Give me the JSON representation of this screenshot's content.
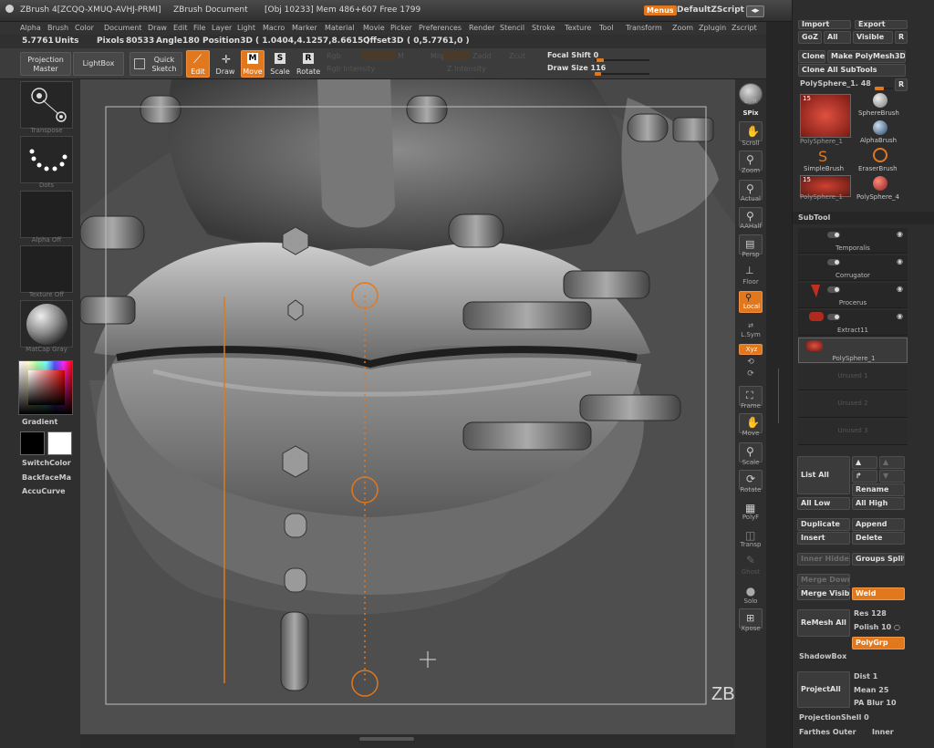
{
  "titlebar": {
    "app": "ZBrush 4[ZCQQ-XMUQ-AVHJ-PRMI]",
    "doc": "ZBrush Document",
    "stats": "[Obj 10233] Mem 486+607 Free 1799",
    "menus_label": "Menus",
    "script_label": "DefaultZScript"
  },
  "menubar": [
    "Alpha",
    "Brush",
    "Color",
    "Document",
    "Draw",
    "Edit",
    "File",
    "Layer",
    "Light",
    "Macro",
    "Marker",
    "Material",
    "Movie",
    "Picker",
    "Preferences",
    "Render",
    "Stencil",
    "Stroke",
    "Texture",
    "Tool",
    "Transform",
    "Zoom",
    "Zplugin",
    "Zscript"
  ],
  "info": {
    "units_value": "5.7761",
    "units_label": "Units",
    "pixols_label": "Pixols",
    "pixols_value": "80533",
    "angle_label": "Angle",
    "angle_value": "180",
    "pos_label": "Position3D",
    "pos_value": "( 1.0404,4.1257,8.6615 )",
    "offset_label": "Offset3D",
    "offset_value": "( 0,5.7761,0 )"
  },
  "toolbar": {
    "projection_master": "Projection Master",
    "lightbox": "LightBox",
    "quick_sketch": "Quick Sketch",
    "edit": "Edit",
    "draw": "Draw",
    "move": "Move",
    "scale": "Scale",
    "rotate": "Rotate",
    "rgb": "Rgb",
    "m": "M",
    "mrgb": "Mrgb",
    "zadd": "Zadd",
    "zsub": "Zsub",
    "zcut": "Zcut",
    "rgb_intensity": "Rgb Intensity",
    "z_intensity": "Z Intensity",
    "focal_shift_label": "Focal Shift",
    "focal_shift_value": "0",
    "draw_size_label": "Draw Size",
    "draw_size_value": "116",
    "draw_size_level": 0.12
  },
  "leftshelf": {
    "transpose": "Transpose",
    "dots": "Dots",
    "alpha": "Alpha Off",
    "texture": "Texture Off",
    "matcap": "MatCap Gray",
    "gradient": "Gradient",
    "switchcolor": "SwitchColor",
    "backface": "BackfaceMa",
    "accucurve": "AccuCurve"
  },
  "rightshelf": [
    "BPR",
    "SPix",
    "Scroll",
    "Zoom",
    "Actual",
    "AAHalf",
    "Persp",
    "Floor",
    "Local",
    "L.Sym",
    "Xyz",
    "Frame",
    "Move",
    "Scale",
    "Rotate",
    "PolyF",
    "Transp",
    "Ghost",
    "Solo",
    "Xpose"
  ],
  "rpanel": {
    "import": "Import",
    "export": "Export",
    "goz": "GoZ",
    "all": "All",
    "visible": "Visible",
    "r": "R",
    "clone": "Clone",
    "make_polymesh": "Make PolyMesh3D",
    "clone_all": "Clone All SubTools",
    "current_tool": "PolySphere_1. 48",
    "tools": [
      "PolySphere_1",
      "SphereBrush",
      "AlphaBrush",
      "SimpleBrush",
      "EraserBrush",
      "PolySphere_1",
      "PolySphere_4"
    ],
    "badge": "15",
    "subtool_title": "SubTool",
    "subtools": [
      "Temporalis",
      "Corrugator",
      "Procerus",
      "Extract11",
      "PolySphere_1",
      "Unused 1",
      "Unused 2",
      "Unused 3"
    ],
    "list_all": "List All",
    "rename": "Rename",
    "all_low": "All Low",
    "all_high": "All High",
    "duplicate": "Duplicate",
    "append": "Append",
    "insert": "Insert",
    "delete": "Delete",
    "inner_hidden": "Inner Hidden",
    "groups_split": "Groups Split",
    "merge_down": "Merge Down",
    "merge_visible": "Merge Visibl",
    "weld": "Weld",
    "remesh_all": "ReMesh All",
    "res_label": "Res",
    "res_value": "128",
    "polish_label": "Polish",
    "polish_value": "10",
    "polygrp": "PolyGrp",
    "shadowbox": "ShadowBox",
    "project_all": "ProjectAll",
    "dist_label": "Dist",
    "dist_value": "1",
    "mean_label": "Mean",
    "mean_value": "25",
    "pa_blur_label": "PA Blur",
    "pa_blur_value": "10",
    "projshell_label": "ProjectionShell",
    "projshell_value": "0",
    "farthest_outer": "Farthes Outer",
    "inner": "Inner"
  },
  "watermark": "ZBrushWorkshops",
  "colors": {
    "accent": "#e2781d",
    "panel": "#2d2d2d",
    "canvas": "#484848"
  }
}
